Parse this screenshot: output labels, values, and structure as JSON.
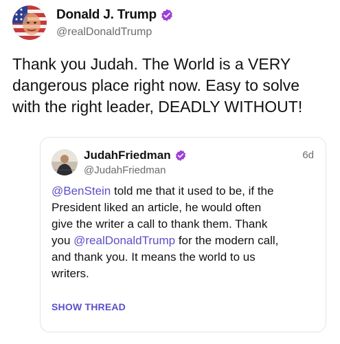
{
  "post": {
    "author_name": "Donald J. Trump",
    "author_handle": "@realDonaldTrump",
    "verified_icon": "verified-badge-icon",
    "text_lines": [
      "Thank you Judah. The World is a VERY",
      "dangerous place right now. Easy to solve",
      "with the right leader, DEADLY WITHOUT!"
    ]
  },
  "quote": {
    "author_name": "JudahFriedman",
    "author_handle": "@JudahFriedman",
    "timestamp": "6d",
    "verified_icon": "verified-badge-icon",
    "line1_mention": "@BenStein",
    "line1_rest": " told me that it used to be, if the",
    "line2": "President liked an article, he would often",
    "line3": "give the writer a call to thank them. Thank",
    "line4_pre": "you ",
    "line4_mention": "@realDonaldTrump",
    "line4_post": " for the modern call,",
    "line5": "and thank you. It means the world to us",
    "line6": "writers.",
    "show_thread_label": "SHOW THREAD"
  },
  "colors": {
    "accent": "#5b4fc7",
    "verified": "#9f3fd6",
    "muted_text": "#6b6b6b",
    "card_border": "#e3e3e8"
  }
}
